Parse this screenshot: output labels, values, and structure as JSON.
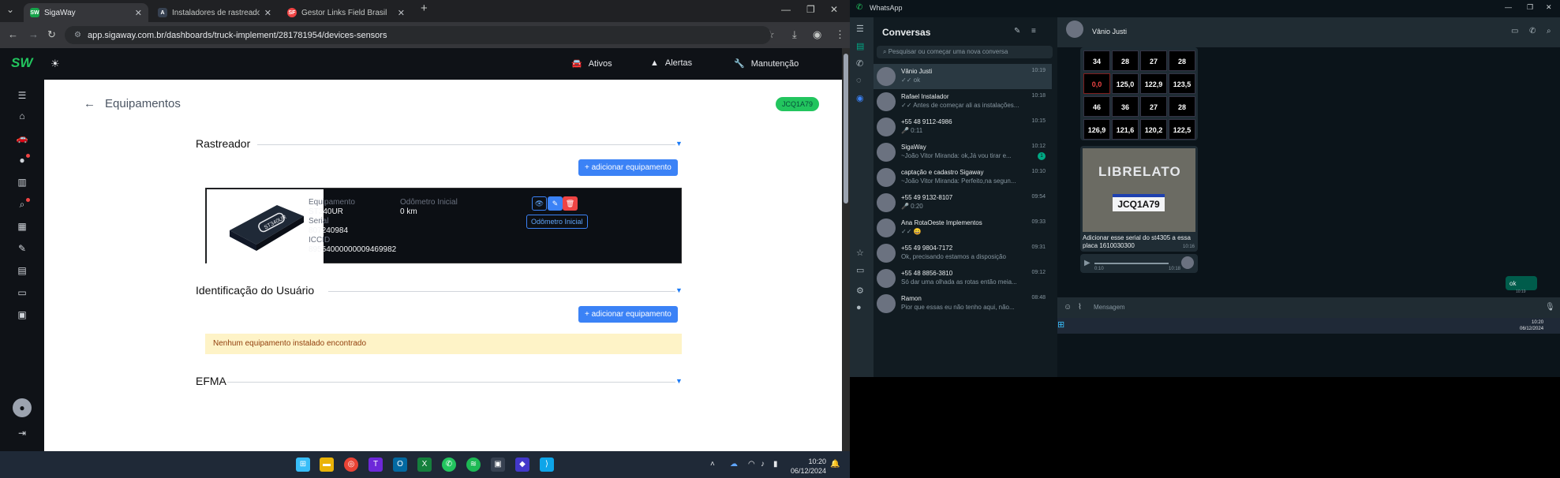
{
  "browser": {
    "tabs": [
      {
        "title": "SigaWay",
        "fav": "SW",
        "color": "#16a34a"
      },
      {
        "title": "Instaladores de rastreador - O q",
        "fav": "A",
        "color": "#111827"
      },
      {
        "title": "Gestor Links Field Brasil",
        "fav": "SF",
        "color": "#ef4444"
      }
    ],
    "url": "app.sigaway.com.br/dashboards/truck-implement/281781954/devices-sensors"
  },
  "app": {
    "logo": "SW",
    "nav": {
      "ativos": "Ativos",
      "alertas": "Alertas",
      "manutencao": "Manutenção"
    },
    "page_title": "Equipamentos",
    "plate": "JCQ1A79",
    "sections": {
      "rastreador": "Rastreador",
      "usuario": "Identificação do Usuário",
      "efma": "EFMA"
    },
    "add_button": "+ adicionar equipamento",
    "device": {
      "equip_label": "Equipamento",
      "equip_value": "ST340UR",
      "serial_label": "Serial",
      "serial_value": "807240984",
      "iccid_label": "ICCID",
      "iccid_value": "89554000000009469982",
      "odo_label": "Odômetro Inicial",
      "odo_value": "0 km",
      "odo_button": "Odômetro Inicial",
      "device_text": "ST340UR"
    },
    "empty_msg": "Nenhum equipamento instalado encontrado"
  },
  "taskbar": {
    "time": "10:20",
    "date": "06/12/2024"
  },
  "whatsapp": {
    "window_title": "WhatsApp",
    "list_title": "Conversas",
    "search_placeholder": "Pesquisar ou começar uma nova conversa",
    "chats": [
      {
        "name": "Vânio Justi",
        "time": "10:19",
        "preview": "✓✓ ok",
        "selected": true
      },
      {
        "name": "Rafael Instalador",
        "time": "10:18",
        "preview": "✓✓ Antes de começar ali as instalações..."
      },
      {
        "name": "+55 48 9112-4986",
        "time": "10:15",
        "preview": "🎤 0:11"
      },
      {
        "name": "SigaWay",
        "time": "10:12",
        "preview": "~João Vitor Miranda: ok,Já vou tirar e...",
        "badge": "1"
      },
      {
        "name": "captação e cadastro Sigaway",
        "time": "10:10",
        "preview": "~João Vitor Miranda: Perfeito,na segun..."
      },
      {
        "name": "+55 49 9132-8107",
        "time": "09:54",
        "preview": "🎤 0:20"
      },
      {
        "name": "Ana RotaOeste Implementos",
        "time": "09:33",
        "preview": "✓✓ 😀"
      },
      {
        "name": "+55 49 9804-7172",
        "time": "09:31",
        "preview": "Ok, precisando estamos a disposição"
      },
      {
        "name": "+55 48 8856-3810",
        "time": "09:12",
        "preview": "Só dar uma olhada as rotas então meia..."
      },
      {
        "name": "Ramon",
        "time": "08:48",
        "preview": "Pior que essas eu não tenho aqui, não..."
      }
    ],
    "contact": "Vânio Justi",
    "tire_values": [
      "34",
      "28",
      "27",
      "28",
      "0,0",
      "125,0",
      "122,9",
      "123,5",
      "46",
      "36",
      "27",
      "28",
      "126,9",
      "121,6",
      "120,2",
      "122,5"
    ],
    "truck_text": "LIBRELATO",
    "truck_plate": "JCQ1A79",
    "caption": "Adicionar esse serial do st4305 a essa placa  1610030300",
    "caption_time": "10:16",
    "audio_len": "0:10",
    "audio_time": "10:18",
    "ok_msg": "ok",
    "ok_time": "10:19",
    "compose_placeholder": "Mensagem"
  }
}
